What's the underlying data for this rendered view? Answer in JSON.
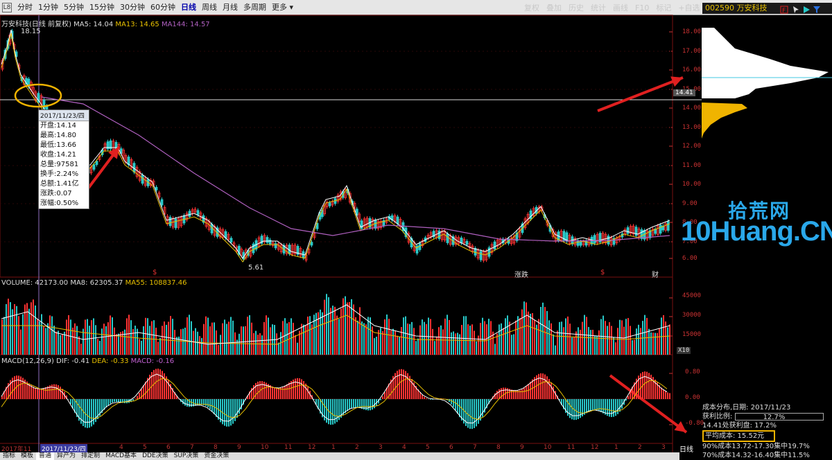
{
  "toolbar": {
    "left_box": "L8",
    "periods": [
      "分时",
      "1分钟",
      "5分钟",
      "15分钟",
      "30分钟",
      "60分钟",
      "日线",
      "周线",
      "月线",
      "多周期",
      "更多"
    ],
    "active_period": "日线",
    "right_items": [
      "复权",
      "叠加",
      "历史",
      "统计",
      "画线",
      "F10",
      "标记",
      "+自选",
      "返回"
    ],
    "stock": "002590 万安科技"
  },
  "main": {
    "title": "万安科技(日线 前复权)",
    "ma5": "MA5: 14.04",
    "ma13": "MA13: 14.65",
    "ma144": "MA144: 14.57",
    "high_label": "18.15",
    "low_label": "5.61",
    "price_line_label": "14.41",
    "y_ticks": [
      "18.00",
      "17.00",
      "16.00",
      "15.00",
      "14.00",
      "13.00",
      "12.00",
      "11.00",
      "10.00",
      "9.00",
      "8.00",
      "7.00",
      "6.00"
    ],
    "markers": [
      "$",
      "涨跌",
      "$",
      "财"
    ]
  },
  "tooltip": {
    "date": "2017/11/23/四",
    "rows": [
      "开盘:14.14",
      "最高:14.80",
      "最低:13.66",
      "收盘:14.21",
      "总量:97581",
      "换手:2.24%",
      "总额:1.41亿",
      "涨跌:0.07",
      "涨幅:0.50%"
    ]
  },
  "volume": {
    "title": "VOLUME: 42173.00",
    "ma8": "MA8: 62305.37",
    "ma55": "MA55: 108837.46",
    "y_ticks": [
      "45000",
      "30000",
      "15000"
    ],
    "unit": "X10"
  },
  "macd": {
    "title": "MACD(12,26,9)",
    "dif": "DIF: -0.41",
    "dea": "DEA: -0.33",
    "macd": "MACD: -0.16",
    "y_ticks": [
      "0.80",
      "0.00",
      "-0.80"
    ]
  },
  "chip": {
    "date_line": "成本分布,日期: 2017/11/23",
    "profit_label": "获利比例:",
    "profit_value": "12.7%",
    "price_line": "14.41处获利盘: 17.2%",
    "avg_cost": "平均成本: 15.52元",
    "c90": "90%成本13.72-17.30集中19.7%",
    "c70": "70%成本14.32-16.40集中11.5%"
  },
  "watermark": {
    "cn": "拾荒网",
    "en": "10Huang.CN"
  },
  "date_strip": {
    "start": "2017年11",
    "current": "2017/11/23/四",
    "months": [
      "4",
      "5",
      "6",
      "7",
      "8",
      "9",
      "10",
      "11",
      "12",
      "1",
      "2",
      "3",
      "4",
      "5",
      "6",
      "7",
      "8",
      "9",
      "10",
      "11",
      "12",
      "1",
      "2",
      "3"
    ]
  },
  "bottom_tabs": [
    "指标",
    "模板",
    "普通",
    "异产为",
    "排定制",
    "MACD基本",
    "DDE决策",
    "SUP决策",
    "资金决策"
  ],
  "daily_label": "日线",
  "colors": {
    "up": "#ff3333",
    "down": "#28c8c8",
    "ma5": "#ffffff",
    "ma13": "#e8c000",
    "ma144": "#b060c0",
    "accent": "#f0b400",
    "arrow": "#e02020"
  }
}
